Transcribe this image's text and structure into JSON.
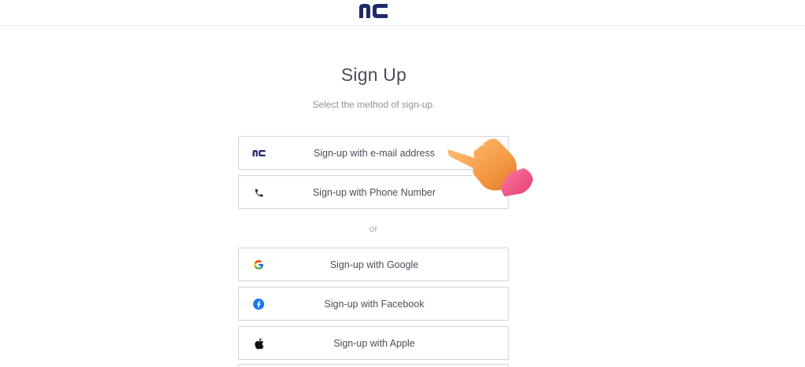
{
  "header": {
    "logo_icon": "nc-logo-icon"
  },
  "main": {
    "title": "Sign Up",
    "subtitle": "Select the method of sign-up.",
    "divider": "or",
    "primary_options": [
      {
        "label": "Sign-up with e-mail address",
        "icon": "nc-logo-icon"
      },
      {
        "label": "Sign-up with Phone Number",
        "icon": "phone-icon"
      }
    ],
    "social_options": [
      {
        "label": "Sign-up with Google",
        "icon": "google-icon"
      },
      {
        "label": "Sign-up with Facebook",
        "icon": "facebook-icon"
      },
      {
        "label": "Sign-up with Apple",
        "icon": "apple-icon"
      }
    ]
  },
  "overlay": {
    "icon": "pointing-hand-icon"
  },
  "colors": {
    "brand_navy": "#1f2a6b",
    "facebook_blue": "#1877f2",
    "border": "#d3d5da",
    "hand_orange": "#f4a04a",
    "hand_cuff_pink": "#ee4f7f"
  }
}
